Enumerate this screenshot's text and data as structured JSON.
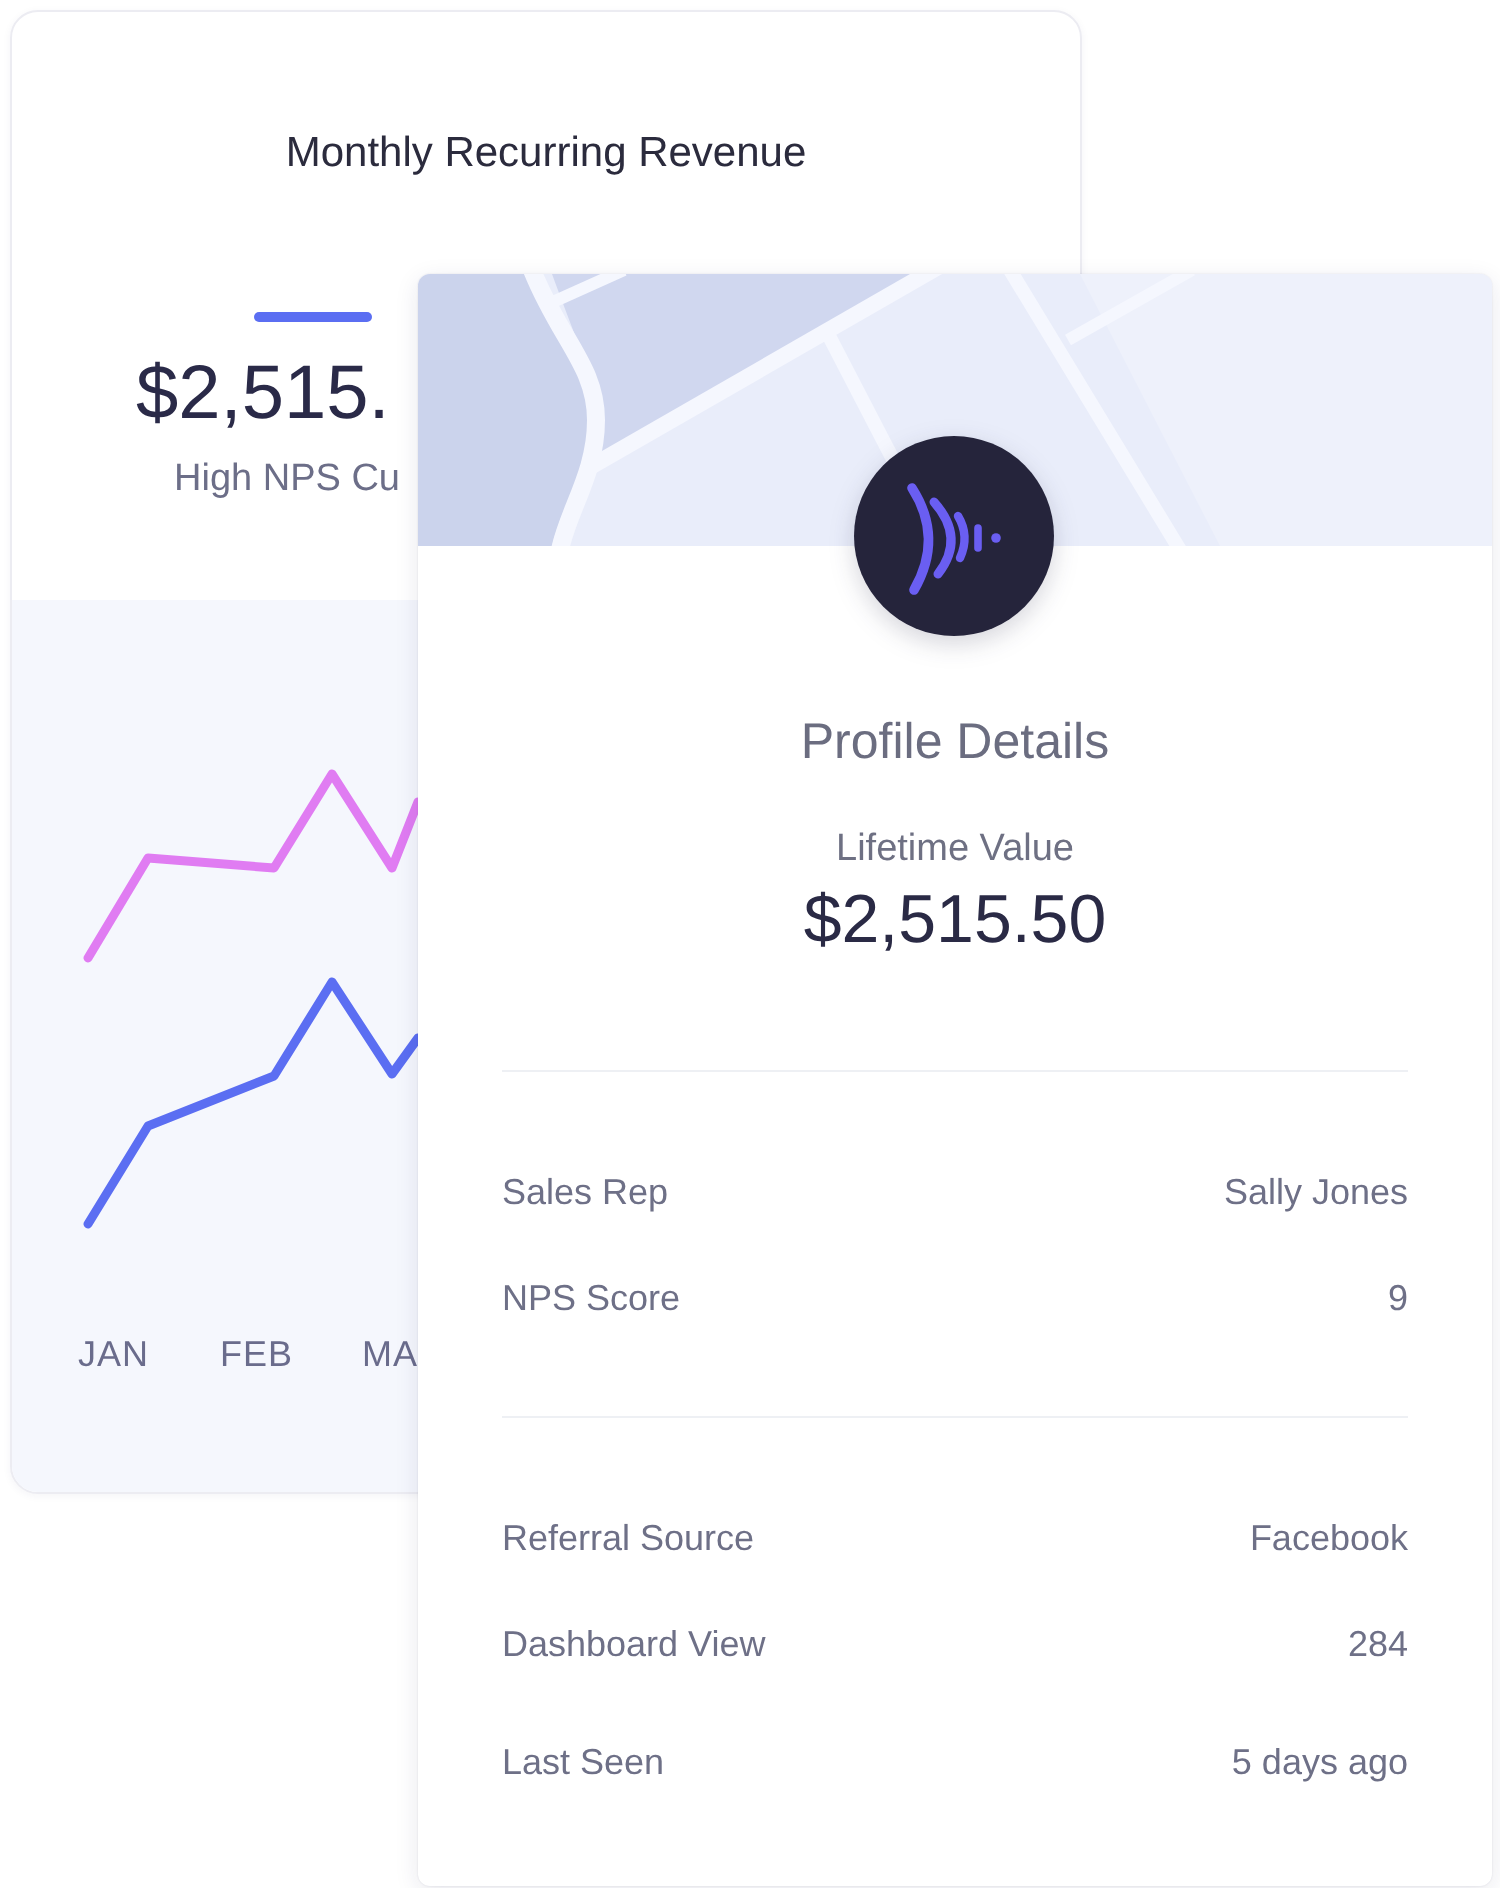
{
  "revenue_card": {
    "title": "Monthly Recurring Revenue",
    "amount": "$2,515.",
    "caption": "High NPS Cu",
    "chart": {
      "lines": [
        {
          "color": "#e07cf2"
        },
        {
          "color": "#5b6ef2"
        }
      ],
      "x_labels": [
        "JAN",
        "FEB",
        "MA"
      ]
    }
  },
  "profile_card": {
    "title": "Profile Details",
    "stat_label": "Lifetime Value",
    "stat_value": "$2,515.50",
    "sections": [
      {
        "rows": [
          {
            "label": "Sales Rep",
            "value": "Sally Jones"
          },
          {
            "label": "NPS Score",
            "value": "9"
          }
        ]
      },
      {
        "rows": [
          {
            "label": "Referral Source",
            "value": "Facebook"
          },
          {
            "label": "Dashboard View",
            "value": "284"
          },
          {
            "label": "Last Seen",
            "value": "5 days ago"
          }
        ]
      }
    ]
  }
}
